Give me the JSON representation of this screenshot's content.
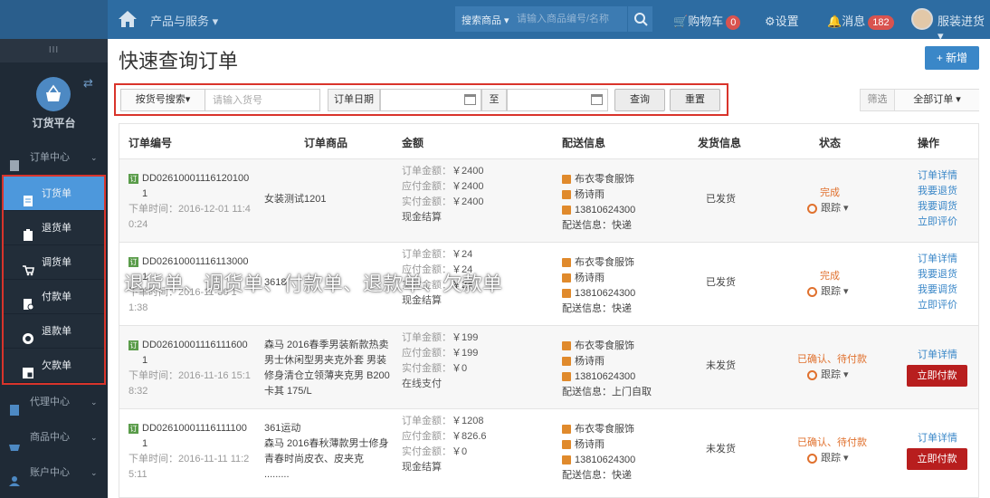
{
  "header": {
    "nav_products": "产品与服务 ▾",
    "search_type": "搜索商品 ▾",
    "search_placeholder": "请输入商品编号/名称",
    "cart_label": "购物车",
    "cart_count": "0",
    "settings_label": "设置",
    "messages_label": "消息",
    "messages_count": "182",
    "user_label": "服装进货 ▾"
  },
  "sidebar": {
    "handle": "III",
    "title": "订货平台",
    "sections": {
      "order_center": "订单中心",
      "agent_center": "代理中心",
      "product_center": "商品中心",
      "account_center": "账户中心"
    },
    "items": [
      {
        "label": "订货单"
      },
      {
        "label": "退货单"
      },
      {
        "label": "调货单"
      },
      {
        "label": "付款单"
      },
      {
        "label": "退款单"
      },
      {
        "label": "欠款单"
      }
    ]
  },
  "page": {
    "title": "快速查询订单",
    "new_button": "+ 新增"
  },
  "filter": {
    "search_by": "按货号搜索▾",
    "input_placeholder": "请输入货号",
    "date_label": "订单日期",
    "to_label": "至",
    "query_button": "查询",
    "reset_button": "重置",
    "filter_label": "筛选",
    "all_orders": "全部订单 ▾"
  },
  "table": {
    "headers": {
      "order_no": "订单编号",
      "goods": "订单商品",
      "amount": "金额",
      "delivery": "配送信息",
      "ship_info": "发货信息",
      "status": "状态",
      "actions": "操作"
    },
    "labels": {
      "order_amount": "订单金额：",
      "payable": "应付金额：",
      "paid": "实付金额：",
      "delivery_info_prefix": "配送信息：",
      "track": "跟踪 ▾"
    },
    "rows": [
      {
        "order_no_1": "DD02610001116120100",
        "order_no_2": "1",
        "time_1": "下单时间：2016-12-01 11:4",
        "time_2": "0:24",
        "goods": "女装测试1201",
        "order_amount": "￥2400",
        "payable": "￥2400",
        "paid": "￥2400",
        "pay_method": "现金结算",
        "store": "布衣零食服饰",
        "contact": "杨诗雨",
        "phone": "13810624300",
        "delivery": "快递",
        "ship_status": "已发货",
        "status": "完成",
        "actions": [
          "订单详情",
          "我要退货",
          "我要调货",
          "立即评价"
        ]
      },
      {
        "order_no_1": "DD02610001116113000",
        "order_no_2": "1",
        "time_1": "下单时间：2016-11-30 1",
        "time_2": "1:38",
        "goods": "3618",
        "order_amount": "￥24",
        "payable": "￥24",
        "paid": "￥24",
        "pay_method": "现金结算",
        "store": "布衣零食服饰",
        "contact": "杨诗雨",
        "phone": "13810624300",
        "delivery": "快递",
        "ship_status": "已发货",
        "status": "完成",
        "actions": [
          "订单详情",
          "我要退货",
          "我要调货",
          "立即评价"
        ]
      },
      {
        "order_no_1": "DD02610001116111600",
        "order_no_2": "1",
        "time_1": "下单时间：2016-11-16 15:1",
        "time_2": "8:32",
        "goods_lines": [
          "森马 2016春季男装新款热卖",
          "男士休闲型男夹克外套 男装",
          "修身清仓立领薄夹克男 B200",
          "卡其 175/L"
        ],
        "order_amount": "￥199",
        "payable": "￥199",
        "paid": "￥0",
        "pay_method": "在线支付",
        "store": "布衣零食服饰",
        "contact": "杨诗雨",
        "phone": "13810624300",
        "delivery": "上门自取",
        "ship_status": "未发货",
        "status": "已确认、待付款",
        "actions": [
          "订单详情"
        ],
        "pay_button": "立即付款"
      },
      {
        "order_no_1": "DD02610001116111100",
        "order_no_2": "1",
        "time_1": "下单时间：2016-11-11 11:2",
        "time_2": "5:11",
        "goods_lines": [
          "361运动",
          "森马 2016春秋薄款男士修身",
          "青春时尚皮衣、皮夹克",
          "........."
        ],
        "order_amount": "￥1208",
        "payable": "￥826.6",
        "paid": "￥0",
        "pay_method": "现金结算",
        "store": "布衣零食服饰",
        "contact": "杨诗雨",
        "phone": "13810624300",
        "delivery": "快递",
        "ship_status": "未发货",
        "status": "已确认、待付款",
        "actions": [
          "订单详情"
        ],
        "pay_button": "立即付款"
      }
    ]
  },
  "overlay": {
    "caption": "退货单、调货单、付款单、退款单、欠款单"
  },
  "colors": {
    "topbar": "#2d6ca2",
    "sidebar": "#1f2a36",
    "active": "#4d98dc",
    "highlight": "#d9342b",
    "pay_button": "#b81e1e"
  }
}
